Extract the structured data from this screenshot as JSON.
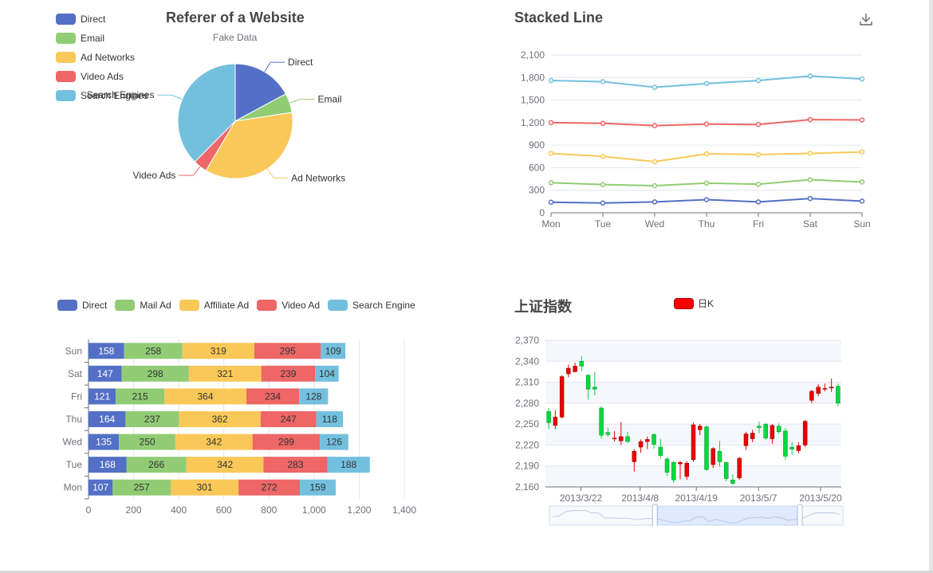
{
  "chart_data": [
    {
      "type": "pie",
      "title": "Referer of a Website",
      "subtitle": "Fake Data",
      "legend": [
        "Direct",
        "Email",
        "Ad Networks",
        "Video Ads",
        "Search Engines"
      ],
      "legend_position": "top-left",
      "slices": [
        {
          "name": "Direct",
          "value": 1048,
          "color": "#5470c6"
        },
        {
          "name": "Email",
          "value": 335,
          "color": "#91cc75"
        },
        {
          "name": "Ad Networks",
          "value": 2200,
          "color": "#fac858"
        },
        {
          "name": "Video Ads",
          "value": 240,
          "color": "#ee6666"
        },
        {
          "name": "Search Engines",
          "value": 2300,
          "color": "#73c0de"
        }
      ]
    },
    {
      "type": "line",
      "title": "Stacked Line",
      "categories": [
        "Mon",
        "Tue",
        "Wed",
        "Thu",
        "Fri",
        "Sat",
        "Sun"
      ],
      "ylim": [
        0,
        2100
      ],
      "yticks": [
        "0",
        "300",
        "600",
        "900",
        "1,200",
        "1,500",
        "1,800",
        "2,100"
      ],
      "grid": true,
      "stacked": true,
      "series": [
        {
          "values": [
            140,
            130,
            145,
            175,
            145,
            190,
            155
          ],
          "color": "#5470c6"
        },
        {
          "values": [
            400,
            375,
            360,
            395,
            380,
            440,
            410
          ],
          "color": "#91cc75"
        },
        {
          "values": [
            790,
            750,
            680,
            785,
            775,
            790,
            810
          ],
          "color": "#fac858"
        },
        {
          "values": [
            1200,
            1190,
            1160,
            1180,
            1175,
            1240,
            1235
          ],
          "color": "#ee6666"
        },
        {
          "values": [
            1760,
            1745,
            1670,
            1720,
            1760,
            1820,
            1780
          ],
          "color": "#73c0de"
        }
      ]
    },
    {
      "type": "bar",
      "orientation": "horizontal",
      "stacked": true,
      "categories": [
        "Mon",
        "Tue",
        "Wed",
        "Thu",
        "Fri",
        "Sat",
        "Sun"
      ],
      "xlim": [
        0,
        1400
      ],
      "xticks": [
        "0",
        "200",
        "400",
        "600",
        "800",
        "1,000",
        "1,200",
        "1,400"
      ],
      "legend_position": "top-left",
      "series": [
        {
          "name": "Direct",
          "values": [
            107,
            168,
            135,
            164,
            121,
            147,
            158
          ],
          "color": "#5470c6"
        },
        {
          "name": "Mail Ad",
          "values": [
            257,
            266,
            250,
            237,
            215,
            298,
            258
          ],
          "color": "#91cc75"
        },
        {
          "name": "Affiliate Ad",
          "values": [
            301,
            342,
            342,
            362,
            364,
            321,
            319
          ],
          "color": "#fac858"
        },
        {
          "name": "Video Ad",
          "values": [
            272,
            283,
            299,
            247,
            234,
            239,
            295
          ],
          "color": "#ee6666"
        },
        {
          "name": "Search Engine",
          "values": [
            159,
            188,
            126,
            118,
            128,
            104,
            109
          ],
          "color": "#73c0de"
        }
      ]
    },
    {
      "type": "candlestick",
      "title": "上证指数",
      "legend": [
        "日K"
      ],
      "ylim": [
        2160,
        2370
      ],
      "yticks": [
        "2,160",
        "2,190",
        "2,220",
        "2,250",
        "2,280",
        "2,310",
        "2,340",
        "2,370"
      ],
      "xticks": [
        "2013/3/22",
        "2013/4/8",
        "2013/4/19",
        "2013/5/7",
        "2013/5/20"
      ],
      "up_color": "#ec0000",
      "down_color": "#00da3c",
      "candles": [
        [
          2268,
          2252,
          2243,
          2273
        ],
        [
          2248,
          2260,
          2243,
          2270
        ],
        [
          2260,
          2318,
          2258,
          2320
        ],
        [
          2322,
          2330,
          2317,
          2335
        ],
        [
          2325,
          2333,
          2324,
          2338
        ],
        [
          2340,
          2333,
          2326,
          2347
        ],
        [
          2320,
          2300,
          2285,
          2321
        ],
        [
          2303,
          2300,
          2291,
          2325
        ],
        [
          2273,
          2234,
          2229,
          2275
        ],
        [
          2238,
          2235,
          2232,
          2245
        ],
        [
          2230,
          2230,
          2225,
          2240
        ],
        [
          2226,
          2232,
          2220,
          2253
        ],
        [
          2232,
          2225,
          2223,
          2239
        ],
        [
          2196,
          2211,
          2182,
          2214
        ],
        [
          2217,
          2225,
          2209,
          2228
        ],
        [
          2225,
          2228,
          2214,
          2232
        ],
        [
          2235,
          2221,
          2215,
          2237
        ],
        [
          2217,
          2205,
          2201,
          2229
        ],
        [
          2200,
          2181,
          2176,
          2203
        ],
        [
          2195,
          2170,
          2166,
          2197
        ],
        [
          2193,
          2195,
          2171,
          2197
        ],
        [
          2175,
          2194,
          2170,
          2197
        ],
        [
          2199,
          2249,
          2196,
          2252
        ],
        [
          2242,
          2247,
          2234,
          2250
        ],
        [
          2246,
          2185,
          2183,
          2248
        ],
        [
          2192,
          2215,
          2187,
          2217
        ],
        [
          2211,
          2196,
          2189,
          2226
        ],
        [
          2195,
          2172,
          2168,
          2196
        ],
        [
          2170,
          2165,
          2163,
          2178
        ],
        [
          2173,
          2201,
          2170,
          2203
        ],
        [
          2219,
          2236,
          2213,
          2239
        ],
        [
          2229,
          2237,
          2224,
          2242
        ],
        [
          2247,
          2245,
          2237,
          2254
        ],
        [
          2250,
          2230,
          2227,
          2251
        ],
        [
          2229,
          2248,
          2222,
          2250
        ],
        [
          2247,
          2239,
          2236,
          2251
        ],
        [
          2240,
          2204,
          2199,
          2244
        ],
        [
          2217,
          2214,
          2206,
          2224
        ],
        [
          2212,
          2219,
          2208,
          2224
        ],
        [
          2220,
          2254,
          2217,
          2256
        ],
        [
          2284,
          2297,
          2280,
          2299
        ],
        [
          2294,
          2303,
          2290,
          2307
        ],
        [
          2301,
          2301,
          2297,
          2308
        ],
        [
          2302,
          2303,
          2296,
          2315
        ],
        [
          2304,
          2280,
          2276,
          2308
        ]
      ]
    }
  ]
}
